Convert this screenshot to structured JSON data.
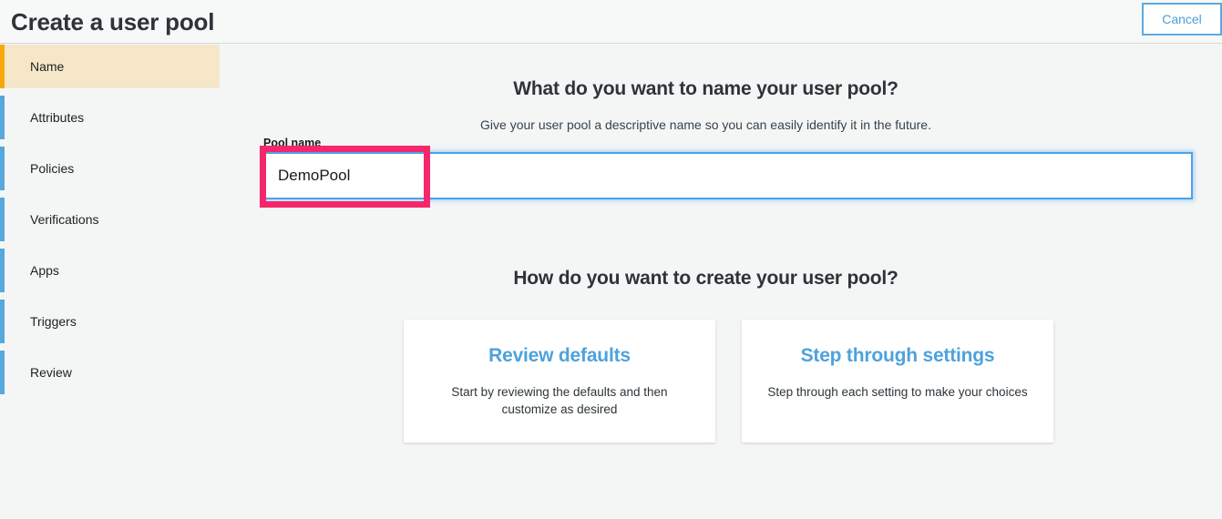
{
  "header": {
    "title": "Create a user pool",
    "cancel_label": "Cancel"
  },
  "sidebar": {
    "items": [
      {
        "label": "Name",
        "active": true,
        "tick_color": "#f7a90b"
      },
      {
        "label": "Attributes",
        "active": false,
        "tick_color": "#56a8dd"
      },
      {
        "label": "Policies",
        "active": false,
        "tick_color": "#56a8dd"
      },
      {
        "label": "Verifications",
        "active": false,
        "tick_color": "#56a8dd"
      },
      {
        "label": "Apps",
        "active": false,
        "tick_color": "#56a8dd"
      },
      {
        "label": "Triggers",
        "active": false,
        "tick_color": "#56a8dd"
      },
      {
        "label": "Review",
        "active": false,
        "tick_color": "#56a8dd"
      }
    ],
    "active_background": "#f7e7c9"
  },
  "main": {
    "name_section": {
      "heading": "What do you want to name your user pool?",
      "subtitle": "Give your user pool a descriptive name so you can easily identify it in the future.",
      "field_label": "Pool name",
      "field_value": "DemoPool",
      "field_placeholder": "",
      "field_focus_color": "#4da2e8"
    },
    "create_section": {
      "heading": "How do you want to create your user pool?",
      "options": [
        {
          "title": "Review defaults",
          "description": "Start by reviewing the defaults and then customize as desired"
        },
        {
          "title": "Step through settings",
          "description": "Step through each setting to make your choices"
        }
      ],
      "link_color": "#4ea2dc"
    }
  },
  "annotation": {
    "highlight_color": "#f4276a",
    "target": "pool-name-input"
  }
}
